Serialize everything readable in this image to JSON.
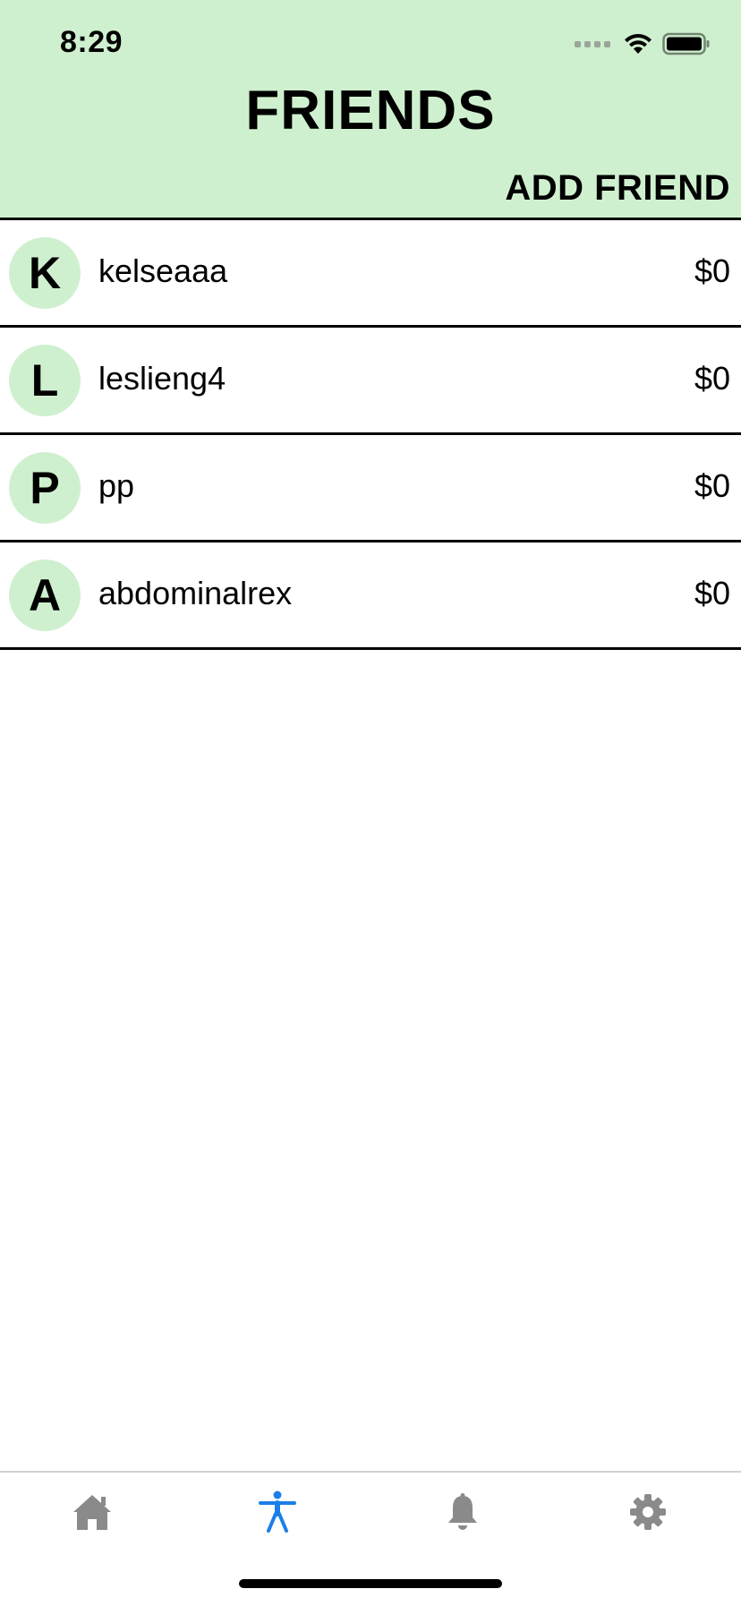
{
  "status_bar": {
    "time": "8:29"
  },
  "header": {
    "title": "FRIENDS",
    "add_friend_label": "ADD FRIEND"
  },
  "friends": [
    {
      "initial": "K",
      "name": "kelseaaa",
      "balance": "$0"
    },
    {
      "initial": "L",
      "name": "leslieng4",
      "balance": "$0"
    },
    {
      "initial": "P",
      "name": "pp",
      "balance": "$0"
    },
    {
      "initial": "A",
      "name": "abdominalrex",
      "balance": "$0"
    }
  ],
  "tab_bar": {
    "tabs": [
      {
        "icon": "home-icon",
        "active": false
      },
      {
        "icon": "person-icon",
        "active": true
      },
      {
        "icon": "bell-icon",
        "active": false
      },
      {
        "icon": "gear-icon",
        "active": false
      }
    ]
  },
  "colors": {
    "header_bg": "#cff0cf",
    "avatar_bg": "#cff0cf",
    "tab_active": "#1a7fe8",
    "tab_inactive": "#8a8a8a"
  }
}
